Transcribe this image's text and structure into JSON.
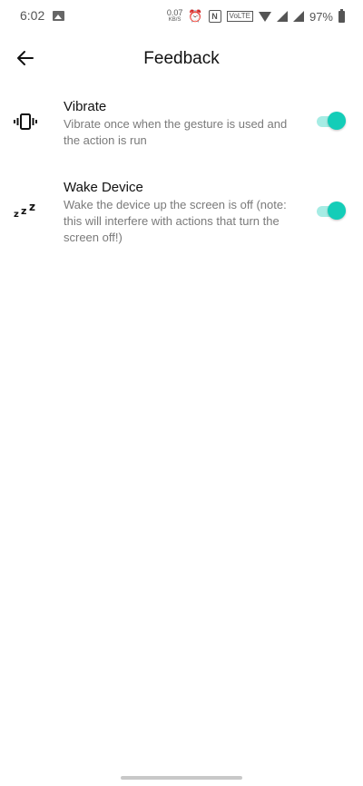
{
  "status_bar": {
    "time": "6:02",
    "net_speed_value": "0.07",
    "net_speed_unit": "KB/S",
    "nfc_label": "N",
    "volte_label": "VoLTE",
    "battery_percent": "97%"
  },
  "header": {
    "title": "Feedback"
  },
  "settings": [
    {
      "icon": "vibrate-icon",
      "title": "Vibrate",
      "description": "Vibrate once when the gesture is used and the action is run",
      "enabled": true
    },
    {
      "icon": "sleep-zzz-icon",
      "title": "Wake Device",
      "description": "Wake the device up the screen is off (note: this will interfere with actions that turn the screen off!)",
      "enabled": true
    }
  ],
  "colors": {
    "accent": "#14cdb8",
    "accent_track": "#a6ece4"
  }
}
